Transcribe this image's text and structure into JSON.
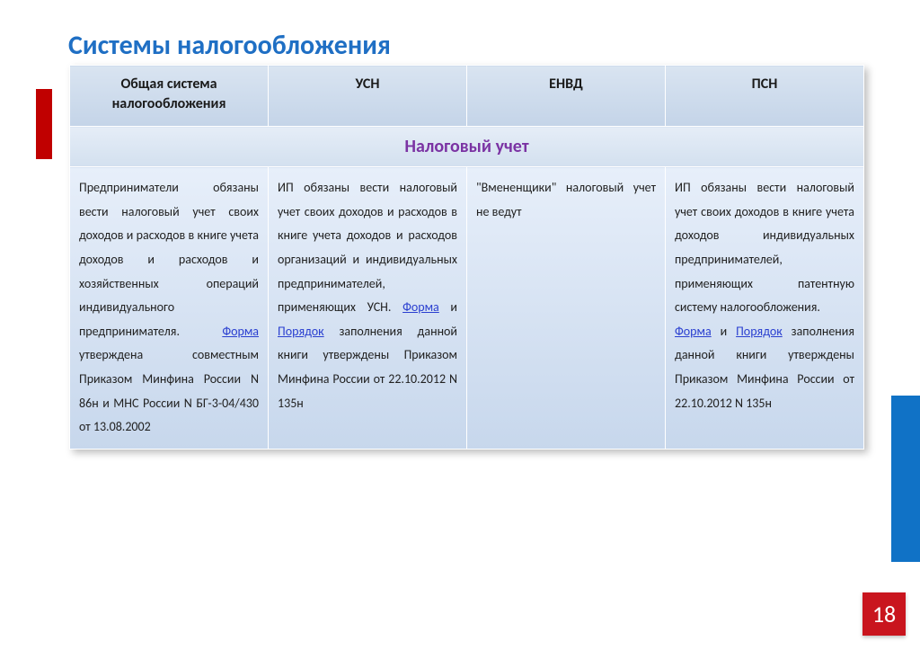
{
  "title": "Системы  налогообложения",
  "page_number": "18",
  "headers": {
    "col1": "Общая система налогообложения",
    "col2": "УСН",
    "col3": "ЕНВД",
    "col4": "ПСН"
  },
  "section_title": "Налоговый учет",
  "cells": {
    "col1": {
      "pre": "Предприниматели обязаны вести налоговый учет своих доходов и расходов в книге учета доходов и расходов и хозяйственных операций индивидуального предпринимателя. ",
      "link1": "Форма",
      "post": " утверждена совместным Приказом Минфина России N 86н и МНС России N БГ-3-04/430 от 13.08.2002"
    },
    "col2": {
      "pre": "ИП обязаны вести налоговый учет своих доходов и расходов в книге учета доходов и расходов организаций и индивидуальных предпринимателей, применяющих УСН. ",
      "link1": "Форма",
      "mid": " и ",
      "link2": "Порядок",
      "post": " заполнения данной книги утверждены Приказом Минфина России от 22.10.2012 N 135н"
    },
    "col3": {
      "text": "\"Вмененщики\" налоговый учет не ведут"
    },
    "col4": {
      "pre": "ИП обязаны вести налоговый учет своих доходов в книге учета доходов индивидуальных предпринимателей, применяющих патентную систему налогообложения.",
      "br": "",
      "link1": "Форма",
      "mid": " и ",
      "link2": "Порядок",
      "post": " заполнения данной книги утверждены Приказом Минфина России от 22.10.2012 N 135н"
    }
  }
}
